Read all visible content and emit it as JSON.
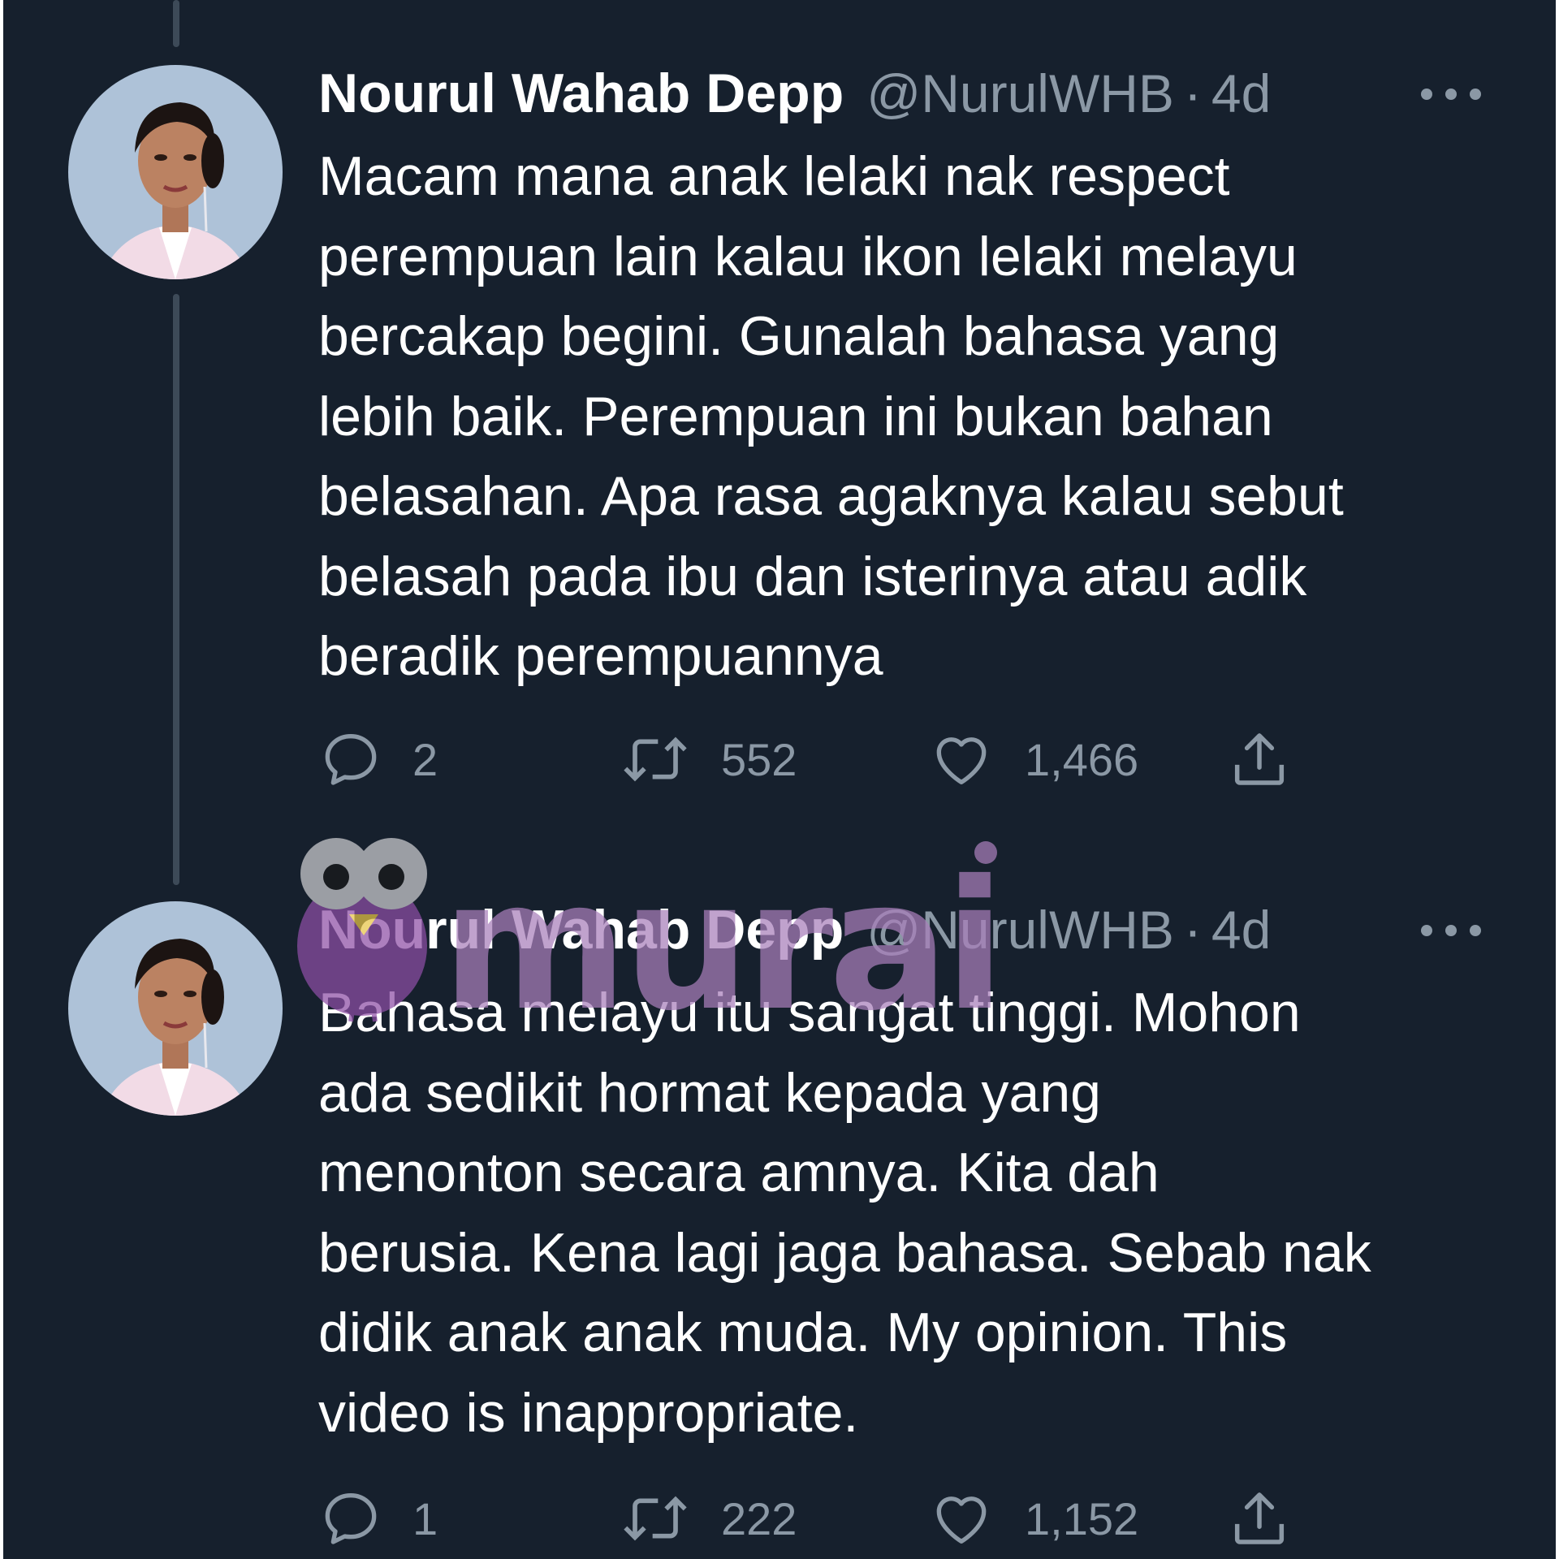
{
  "tweets": [
    {
      "author": {
        "name": "Nourul Wahab Depp",
        "handle": "@NurulWHB",
        "separator": "·",
        "time": "4d"
      },
      "text_lines": [
        "Macam mana anak lelaki nak respect",
        "perempuan lain kalau ikon lelaki melayu",
        "bercakap begini. Gunalah bahasa yang",
        "lebih baik. Perempuan ini bukan bahan",
        "belasahan. Apa rasa agaknya kalau sebut",
        "belasah pada ibu dan isterinya atau adik",
        "beradik perempuannya"
      ],
      "actions": {
        "replies": "2",
        "retweets": "552",
        "likes": "1,466"
      }
    },
    {
      "author": {
        "name": "Nourul Wahab Depp",
        "handle": "@NurulWHB",
        "separator": "·",
        "time": "4d"
      },
      "text_lines": [
        "Bahasa melayu itu sangat tinggi. Mohon",
        "ada sedikit hormat kepada yang",
        "menonton secara amnya. Kita dah",
        "berusia. Kena lagi jaga bahasa. Sebab nak",
        "didik anak anak muda.  My opinion. This",
        "video is inappropriate."
      ],
      "actions": {
        "replies": "1",
        "retweets": "222",
        "likes": "1,152"
      }
    }
  ],
  "watermark": {
    "text": "murai",
    "color": "#a97fbb"
  },
  "colors": {
    "background": "#16202d",
    "text": "#ffffff",
    "muted": "#8b98a5",
    "thread_line": "#3d4a58"
  },
  "icons": [
    "more-dots-icon",
    "reply-icon",
    "retweet-icon",
    "like-icon",
    "share-icon",
    "avatar-photo"
  ]
}
